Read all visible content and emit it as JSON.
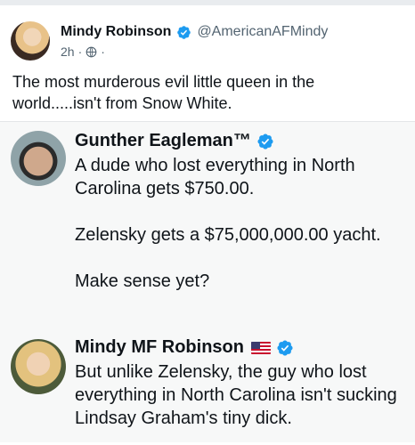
{
  "post": {
    "author_name": "Mindy Robinson",
    "author_handle": "@AmericanAFMindy",
    "time": "2h",
    "separator": "·",
    "text": "The most murderous evil little queen in the world.....isn't from Snow White."
  },
  "embed": {
    "tweets": [
      {
        "author_name": "Gunther Eagleman™",
        "lines": [
          "A dude who lost everything in North Carolina gets $750.00.",
          "",
          "Zelensky gets a $75,000,000.00 yacht.",
          "",
          "Make sense yet?"
        ]
      },
      {
        "author_name": "Mindy MF Robinson",
        "lines": [
          "But unlike Zelensky, the guy who lost everything in North Carolina isn't sucking Lindsay Graham's tiny dick."
        ]
      }
    ]
  },
  "colors": {
    "verified_blue": "#1d9bf0",
    "secondary_text": "#536471",
    "primary_text": "#0f1419"
  },
  "icons": {
    "verified": "verified-badge-icon",
    "audience": "globe-icon",
    "flag": "us-flag-icon"
  }
}
